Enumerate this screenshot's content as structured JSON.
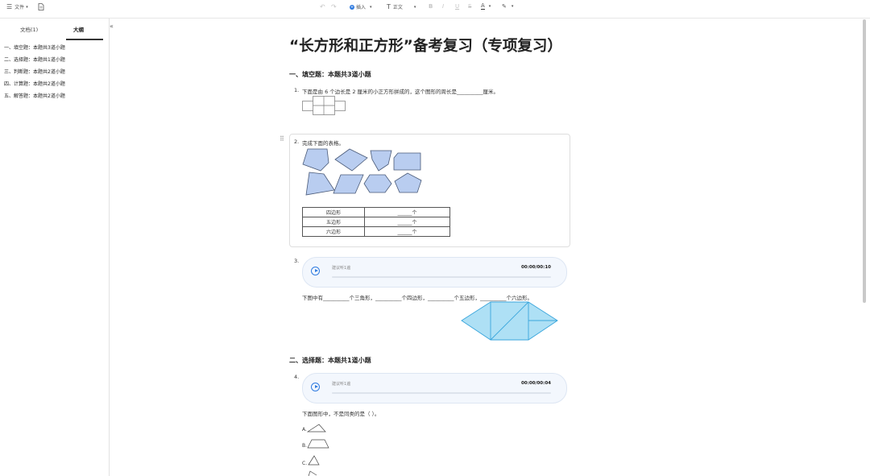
{
  "toolbar": {
    "file_label": "文件",
    "insert_label": "插入",
    "text_style_label": "正文"
  },
  "sidebar": {
    "tabs": [
      "文档(1)",
      "大纲"
    ],
    "active_tab": 1,
    "outline": [
      "一、填空题：本题共3道小题",
      "二、选择题：本题共1道小题",
      "三、判断题：本题共2道小题",
      "四、计算题：本题共2道小题",
      "五、解答题：本题共2道小题"
    ]
  },
  "document": {
    "title": "“长方形和正方形”备考复习（专项复习）",
    "sections": [
      {
        "heading": "一、填空题：本题共3道小题"
      },
      {
        "heading": "二、选择题：本题共1道小题"
      }
    ],
    "q1": {
      "number": "1.",
      "text": "下面是由 6 个边长是 2 厘米的小正方形拼成的，这个图形的周长是__________厘米。"
    },
    "q2": {
      "number": "2.",
      "text": "完成下面的表格。",
      "table": [
        [
          "四边形",
          "______个"
        ],
        [
          "五边形",
          "______个"
        ],
        [
          "六边形",
          "______个"
        ]
      ]
    },
    "q3": {
      "number": "3.",
      "audio": {
        "hint": "建议听1遍",
        "time": "00:00/00:10"
      },
      "text": "下图中有__________个三角形，__________个四边形，__________个五边形，__________个六边形。"
    },
    "q4": {
      "number": "4.",
      "audio": {
        "hint": "建议听1遍",
        "time": "00:00/00:04"
      },
      "text": "下面图形中，不是同类的是（    ）。",
      "options": [
        "A.",
        "B.",
        "C."
      ]
    }
  },
  "colors": {
    "shape_fill": "#b9cdf0",
    "shape_stroke": "#4a5a78",
    "figure_fill": "#aee0f5",
    "figure_stroke": "#3aa6dc",
    "accent": "#2f7be0"
  }
}
